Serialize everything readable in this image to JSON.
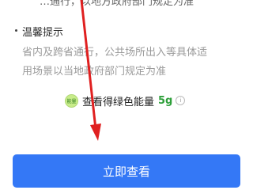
{
  "top_cut_text": "…通行，以地方政府部门规定为准",
  "tip": {
    "title": "温馨提示",
    "line1": "省内及跨省通行，公共场所出入等具体适",
    "line2": "用场景以当地政府部门规定为准"
  },
  "energy": {
    "badge_text": "能量",
    "label": "查看得绿色能量",
    "amount": "5g",
    "info_icon": "info-icon"
  },
  "primary_button": {
    "label": "立即查看",
    "color": "#3478f6"
  },
  "annotation": {
    "icon": "arrow-down-right-icon",
    "color": "#e02020"
  }
}
